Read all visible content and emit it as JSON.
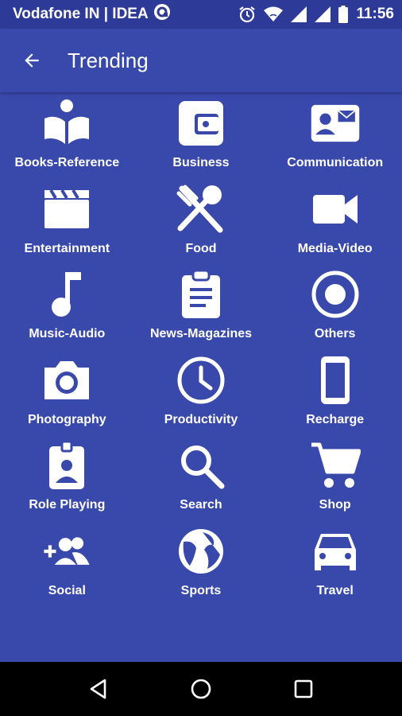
{
  "status_bar": {
    "carrier": "Vodafone IN | IDEA",
    "time": "11:56"
  },
  "app_bar": {
    "title": "Trending",
    "back_icon": "arrow-left-icon"
  },
  "categories": [
    {
      "label": "Books-Reference",
      "icon": "book-reader-icon"
    },
    {
      "label": "Business",
      "icon": "wallet-icon"
    },
    {
      "label": "Communication",
      "icon": "contact-mail-icon"
    },
    {
      "label": "Entertainment",
      "icon": "clapperboard-icon"
    },
    {
      "label": "Food",
      "icon": "fork-spoon-icon"
    },
    {
      "label": "Media-Video",
      "icon": "video-camera-icon"
    },
    {
      "label": "Music-Audio",
      "icon": "music-note-icon"
    },
    {
      "label": "News-Magazines",
      "icon": "clipboard-icon"
    },
    {
      "label": "Others",
      "icon": "radio-button-icon"
    },
    {
      "label": "Photography",
      "icon": "camera-icon"
    },
    {
      "label": "Productivity",
      "icon": "clock-icon"
    },
    {
      "label": "Recharge",
      "icon": "phone-icon"
    },
    {
      "label": "Role Playing",
      "icon": "badge-icon"
    },
    {
      "label": "Search",
      "icon": "search-icon"
    },
    {
      "label": "Shop",
      "icon": "shopping-cart-icon"
    },
    {
      "label": "Social",
      "icon": "add-group-icon"
    },
    {
      "label": "Sports",
      "icon": "globe-icon"
    },
    {
      "label": "Travel",
      "icon": "car-icon"
    }
  ],
  "colors": {
    "primary": "#3949ab",
    "status_bar": "#2d3a97",
    "nav_bar": "#000000",
    "foreground": "#ffffff"
  }
}
